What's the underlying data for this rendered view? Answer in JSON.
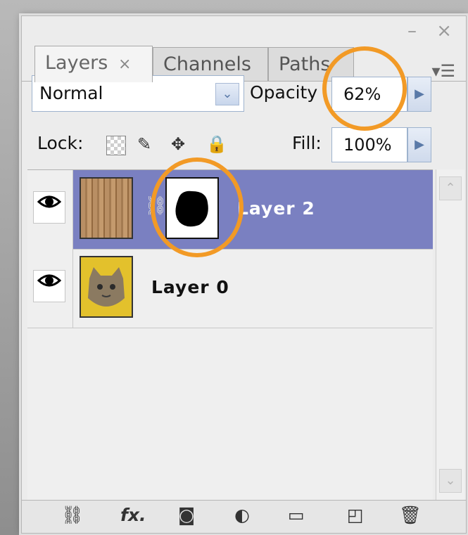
{
  "panel": {
    "window_controls": "– ×",
    "menu_icon": "menu-icon",
    "tabs": [
      {
        "label": "Layers",
        "close": "×"
      },
      {
        "label": "Channels"
      },
      {
        "label": "Paths"
      }
    ]
  },
  "controls": {
    "blend_mode": "Normal",
    "opacity_label": "Opacity",
    "opacity_value": "62%",
    "lock_label": "Lock:",
    "fill_label": "Fill:",
    "fill_value": "100%"
  },
  "layers": [
    {
      "name": "Layer 2"
    },
    {
      "name": "Layer 0"
    }
  ],
  "colors": {
    "selection": "#7a80c1",
    "highlight_circle": "#f29a26"
  }
}
